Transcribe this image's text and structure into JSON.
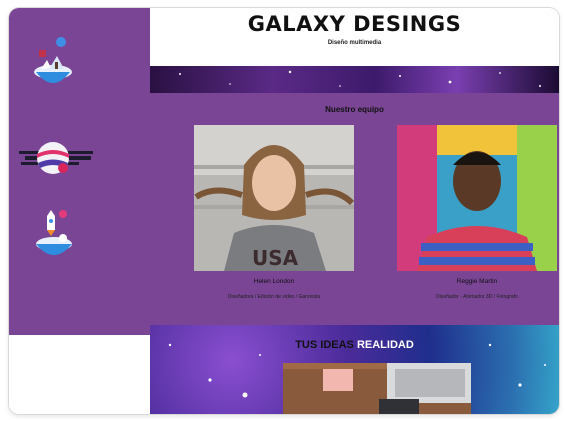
{
  "header": {
    "brand": "GALAXY DESINGS",
    "tagline": "Diseño multimedia"
  },
  "sidebar": {
    "icons": [
      "floating-island-icon",
      "planet-icon",
      "rocket-island-icon"
    ]
  },
  "team": {
    "title": "Nuestro equipo",
    "members": [
      {
        "name": "Helen London",
        "role": "Diseñadora / Edición de video / Garonista"
      },
      {
        "name": "Reggie Martin",
        "role": "Diseñador - Animador 3D / Fotografo"
      }
    ]
  },
  "hero": {
    "title_part1": "TUS IDEAS",
    "title_part2": "REALIDAD"
  },
  "colors": {
    "purple": "#7a4595",
    "header_bg": "#ffffff"
  }
}
